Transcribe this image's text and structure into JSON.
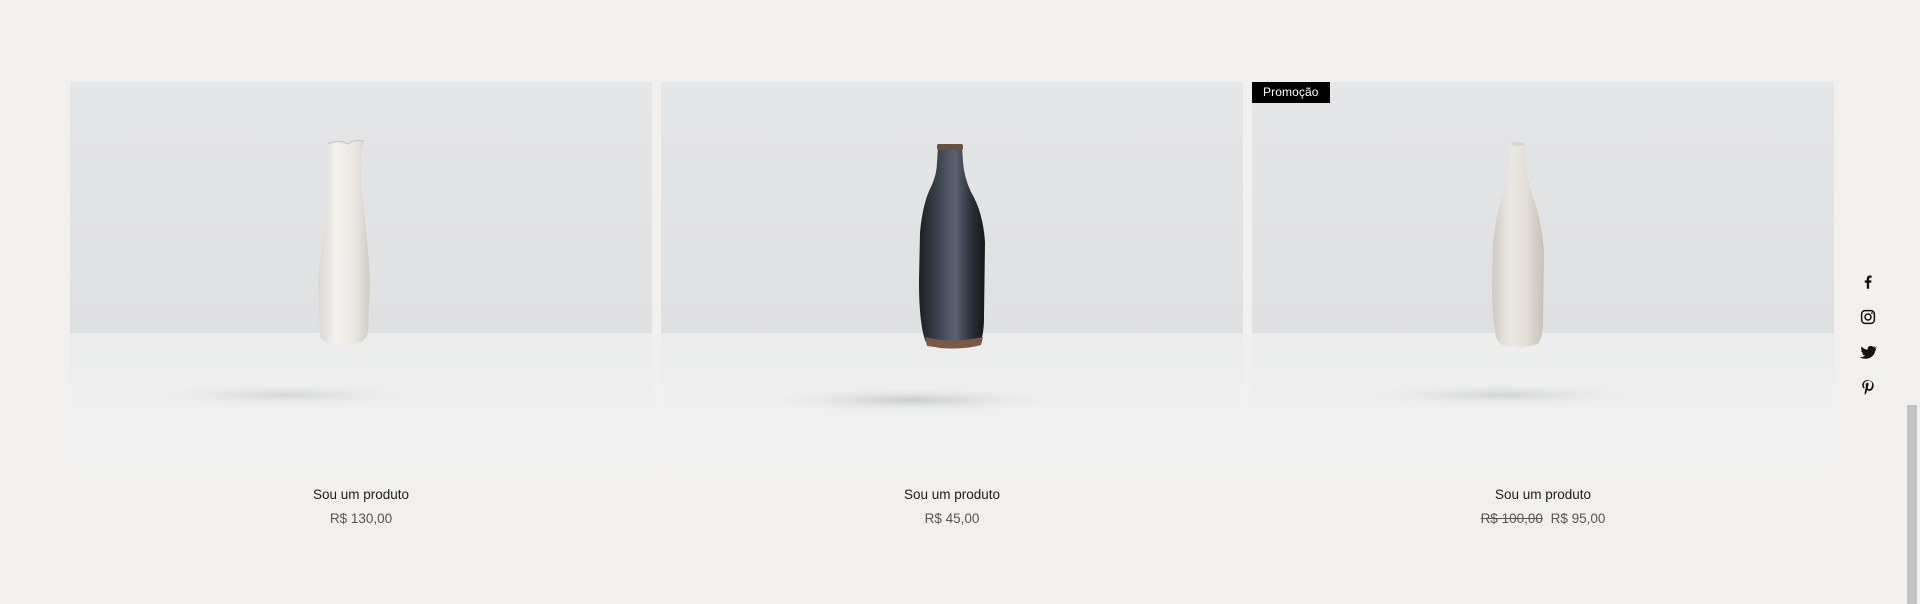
{
  "products": [
    {
      "name": "Sou um produto",
      "price": "R$ 130,00",
      "badge": "",
      "original_price": "",
      "vessel": "white-pitcher-vase"
    },
    {
      "name": "Sou um produto",
      "price": "R$ 45,00",
      "badge": "",
      "original_price": "",
      "vessel": "dark-glazed-bottle"
    },
    {
      "name": "Sou um produto",
      "price": "R$ 95,00",
      "badge": "Promoção",
      "original_price": "R$ 100,00",
      "vessel": "white-bottle"
    }
  ],
  "social": [
    {
      "icon": "facebook-icon"
    },
    {
      "icon": "instagram-icon"
    },
    {
      "icon": "twitter-icon"
    },
    {
      "icon": "pinterest-icon"
    }
  ],
  "colors": {
    "background": "#f1f0ee",
    "badge_bg": "#000000",
    "badge_text": "#ffffff",
    "product_name": "#1c1c1c",
    "price": "#555555"
  }
}
